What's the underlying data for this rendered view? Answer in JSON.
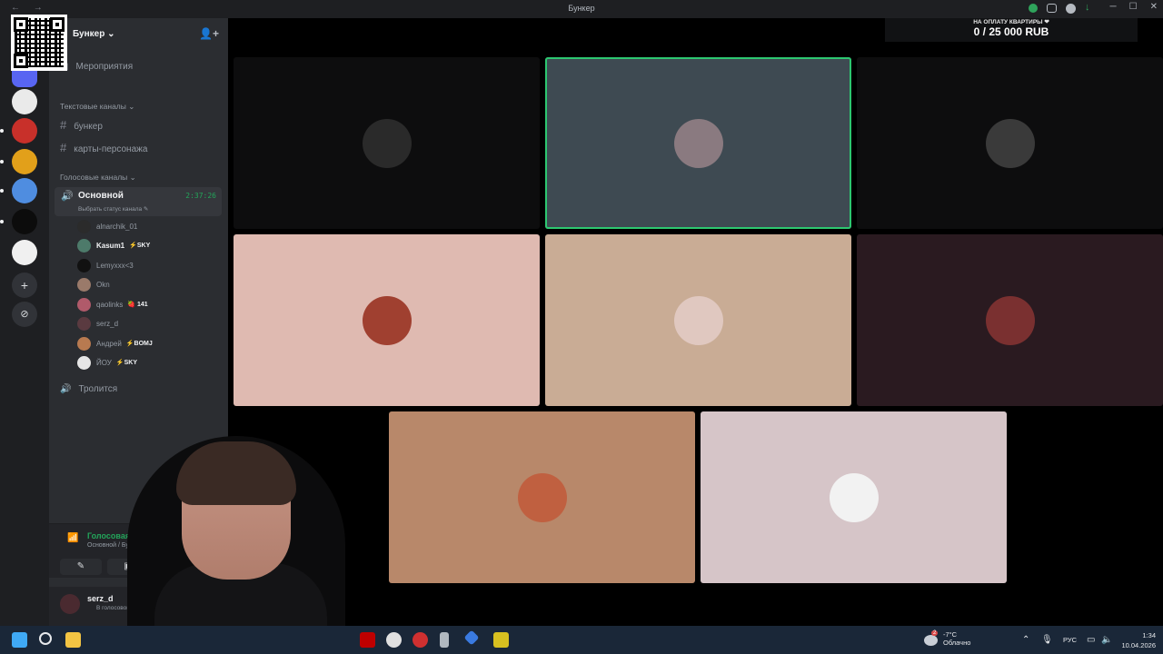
{
  "window": {
    "title": "Бункер",
    "nav": "← →"
  },
  "server": {
    "name": "Бункер",
    "badge_label": "бункер"
  },
  "sidebar": {
    "events_label": "Мероприятия",
    "text_category": "Текстовые каналы",
    "text_channels": [
      "бункер",
      "карты-персонажа"
    ],
    "voice_category": "Голосовые каналы",
    "active_voice": {
      "name": "Основной",
      "timer": "2:37:26",
      "status_prompt": "Выбрать статус канала"
    },
    "members": [
      {
        "name": "alnarchik_01",
        "tag": "",
        "bold": false,
        "color": "#2b2b2b"
      },
      {
        "name": "Kasum1",
        "tag": "⚡SKY",
        "bold": true,
        "color": "#4d7a6a"
      },
      {
        "name": "Lemyxxx<3",
        "tag": "",
        "bold": false,
        "color": "#111111"
      },
      {
        "name": "Okn",
        "tag": "",
        "bold": false,
        "color": "#9a7a6a"
      },
      {
        "name": "qaolinks",
        "tag": "🍓 141",
        "bold": false,
        "color": "#b05a6a"
      },
      {
        "name": "serz_d",
        "tag": "",
        "bold": false,
        "color": "#5a3a40"
      },
      {
        "name": "Андрей",
        "tag": "⚡BOMJ",
        "bold": false,
        "color": "#b87a50"
      },
      {
        "name": "ЙОУ",
        "tag": "⚡SKY",
        "bold": false,
        "color": "#e6e6e6"
      }
    ],
    "other_voice": "Тролится",
    "voice_connected": {
      "label": "Голосовая связь",
      "location": "Основной / Бункер"
    },
    "user": {
      "name": "serz_d",
      "status": "В голосовом чате"
    }
  },
  "donation": {
    "label": "НА ОПЛАТУ КВАРТИРЫ ❤",
    "value": "0 / 25 000 RUB"
  },
  "tiles": [
    {
      "bg": "#0d0d0e",
      "avatar": "#2a2a2a",
      "speaking": false
    },
    {
      "bg": "#3e4a52",
      "avatar": "#8a7a80",
      "speaking": true
    },
    {
      "bg": "#0d0d0e",
      "avatar": "#3a3a3a",
      "speaking": false
    },
    {
      "bg": "#dfbab1",
      "avatar": "#a04030",
      "speaking": false
    },
    {
      "bg": "#c9ac95",
      "avatar": "#e0c8c0",
      "speaking": false
    },
    {
      "bg": "#2a1a20",
      "avatar": "#7a3030",
      "speaking": false
    },
    {
      "bg": "#b8886a",
      "avatar": "#c06040",
      "speaking": false
    },
    {
      "bg": "#d6c5c8",
      "avatar": "#f2f2f2",
      "speaking": false
    }
  ],
  "taskbar": {
    "weather_temp": "-7°C",
    "weather_text": "Облачно",
    "weather_badge": "2",
    "lang": "РУС",
    "time": "1:34",
    "date": "10.04.2026"
  }
}
